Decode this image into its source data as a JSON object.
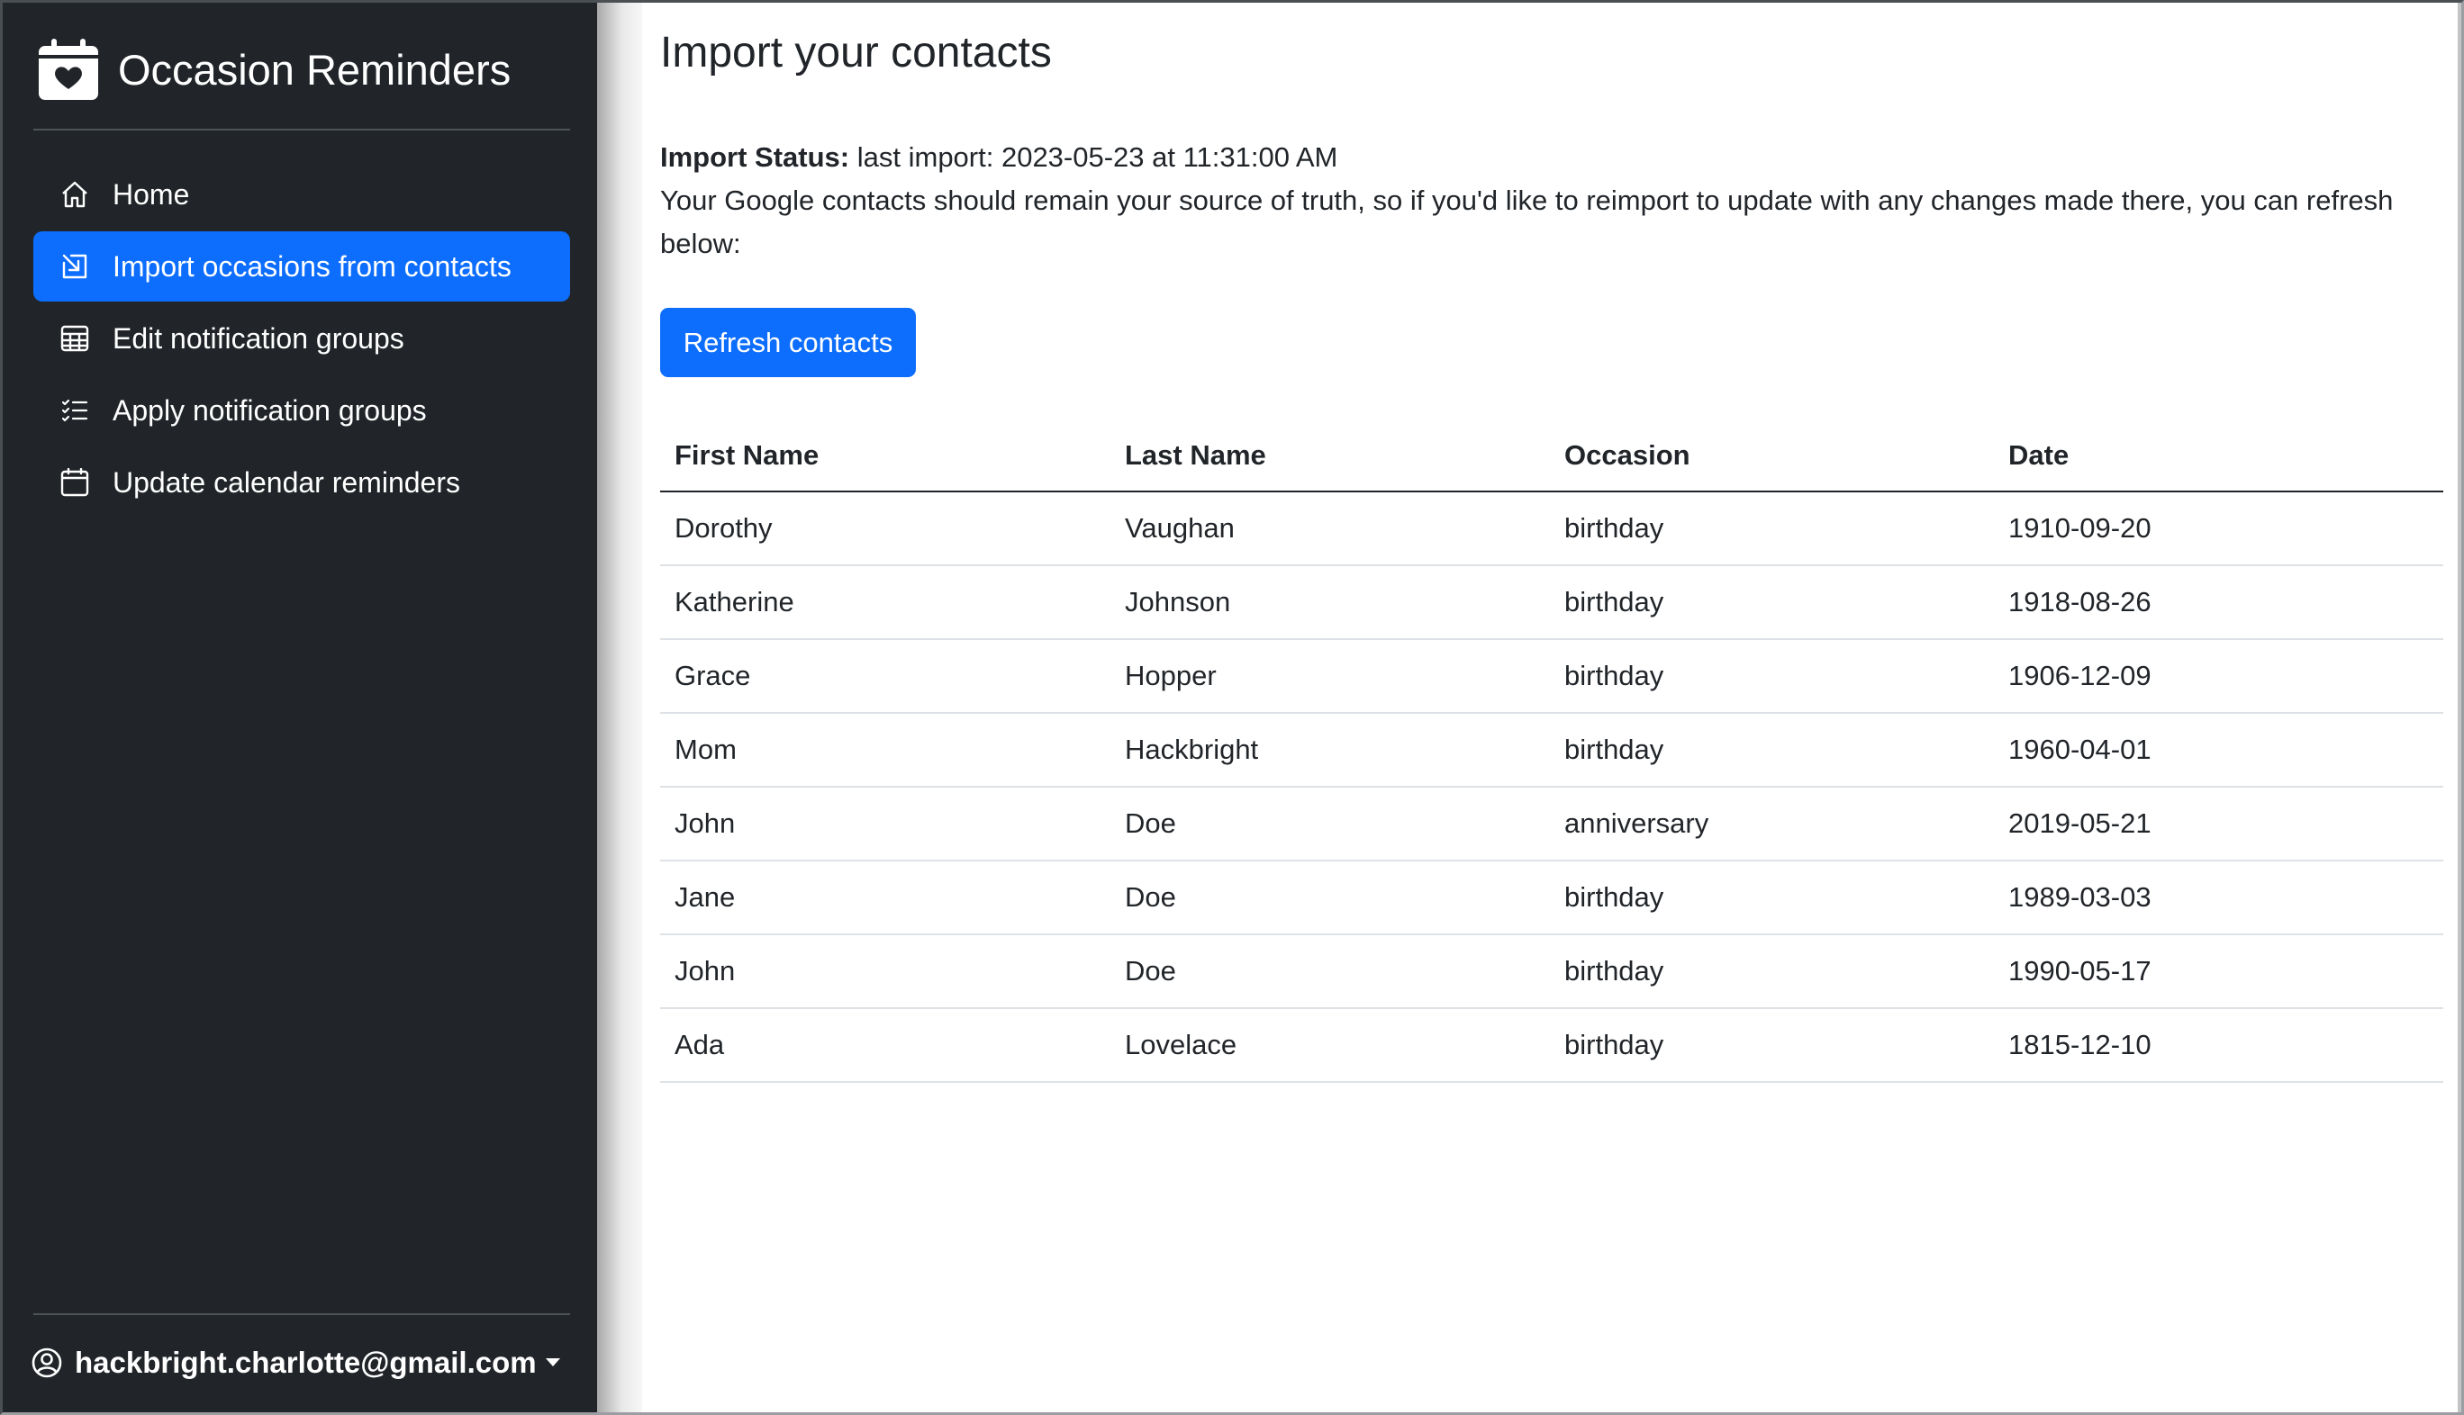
{
  "app": {
    "title": "Occasion Reminders",
    "icon": "calendar-heart-icon"
  },
  "sidebar": {
    "items": [
      {
        "label": "Home",
        "icon": "house-icon",
        "active": false
      },
      {
        "label": "Import occasions from contacts",
        "icon": "box-arrow-in-down-right-icon",
        "active": true
      },
      {
        "label": "Edit notification groups",
        "icon": "table-icon",
        "active": false
      },
      {
        "label": "Apply notification groups",
        "icon": "list-check-icon",
        "active": false
      },
      {
        "label": "Update calendar reminders",
        "icon": "calendar-icon",
        "active": false
      }
    ],
    "user": {
      "email": "hackbright.charlotte@gmail.com",
      "icon": "person-circle-icon"
    }
  },
  "main": {
    "title": "Import your contacts",
    "status_label": "Import Status:",
    "status_value": "last import: 2023-05-23 at 11:31:00 AM",
    "description": "Your Google contacts should remain your source of truth, so if you'd like to reimport to update with any changes made there, you can refresh below:",
    "refresh_button": "Refresh contacts",
    "table": {
      "headers": [
        "First Name",
        "Last Name",
        "Occasion",
        "Date"
      ],
      "rows": [
        [
          "Dorothy",
          "Vaughan",
          "birthday",
          "1910-09-20"
        ],
        [
          "Katherine",
          "Johnson",
          "birthday",
          "1918-08-26"
        ],
        [
          "Grace",
          "Hopper",
          "birthday",
          "1906-12-09"
        ],
        [
          "Mom",
          "Hackbright",
          "birthday",
          "1960-04-01"
        ],
        [
          "John",
          "Doe",
          "anniversary",
          "2019-05-21"
        ],
        [
          "Jane",
          "Doe",
          "birthday",
          "1989-03-03"
        ],
        [
          "John",
          "Doe",
          "birthday",
          "1990-05-17"
        ],
        [
          "Ada",
          "Lovelace",
          "birthday",
          "1815-12-10"
        ]
      ]
    }
  },
  "colors": {
    "sidebar_bg": "#212529",
    "accent": "#0d6efd",
    "text": "#212529"
  }
}
